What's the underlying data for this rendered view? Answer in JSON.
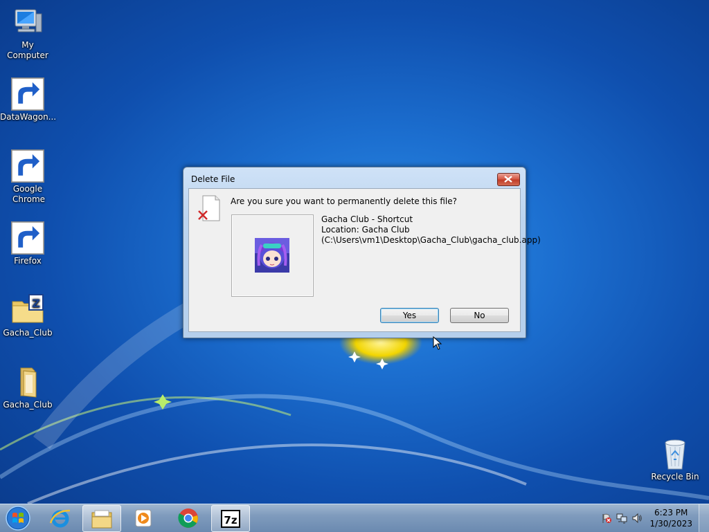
{
  "desktop": {
    "icons": [
      {
        "label": "My Computer",
        "icon": "computer-icon"
      },
      {
        "label": "DataWagon...",
        "icon": "datawagon-icon"
      },
      {
        "label": "Google Chrome",
        "icon": "chrome-icon"
      },
      {
        "label": "Firefox",
        "icon": "firefox-icon"
      },
      {
        "label": "Gacha_Club",
        "icon": "zip-folder-icon"
      },
      {
        "label": "Gacha_Club",
        "icon": "folder-icon"
      }
    ],
    "recycle_bin": {
      "label": "Recycle Bin",
      "icon": "recycle-bin-icon"
    }
  },
  "dialog": {
    "title": "Delete File",
    "question": "Are you sure you want to permanently delete this file?",
    "file_name": "Gacha Club - Shortcut",
    "location": "Location: Gacha Club",
    "path": "(C:\\Users\\vm1\\Desktop\\Gacha_Club\\gacha_club.app)",
    "yes_label": "Yes",
    "no_label": "No"
  },
  "taskbar": {
    "items": [
      "start-orb",
      "internet-explorer-icon",
      "file-explorer-icon",
      "media-player-icon",
      "chrome-icon",
      "7zip-icon"
    ],
    "clock_time": "6:23 PM",
    "clock_date": "1/30/2023"
  },
  "colors": {
    "accent": "#1c6fd0",
    "close": "#c03a27"
  }
}
